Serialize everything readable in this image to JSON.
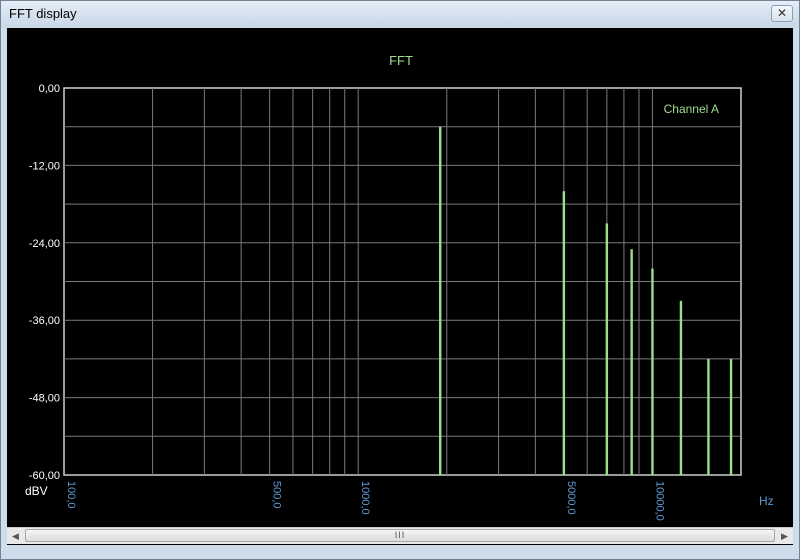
{
  "window": {
    "title": "FFT display",
    "close_glyph": "✕"
  },
  "scrollbar": {
    "left_arrow": "◀",
    "right_arrow": "▶",
    "grip": "III"
  },
  "colors": {
    "plot_background": "#000000",
    "grid": "#7a7a7a",
    "series": "#9edc8e",
    "x_tick": "#5b9bd5",
    "y_tick": "#ffffff"
  },
  "chart_data": {
    "type": "bar",
    "title": "FFT",
    "xlabel": "Hz",
    "ylabel": "dBV",
    "x_scale": "log",
    "xlim": [
      100,
      20000
    ],
    "ylim": [
      -60,
      0
    ],
    "x_ticks": [
      {
        "value": 100,
        "label": "100,0"
      },
      {
        "value": 500,
        "label": "500,0"
      },
      {
        "value": 1000,
        "label": "1000,0"
      },
      {
        "value": 5000,
        "label": "5000,0"
      },
      {
        "value": 10000,
        "label": "10000,0"
      }
    ],
    "y_ticks": [
      {
        "value": 0,
        "label": "0,00"
      },
      {
        "value": -12,
        "label": "-12,00"
      },
      {
        "value": -24,
        "label": "-24,00"
      },
      {
        "value": -36,
        "label": "-36,00"
      },
      {
        "value": -48,
        "label": "-48,00"
      },
      {
        "value": -60,
        "label": "-60,00"
      }
    ],
    "grid": true,
    "legend": "top-right",
    "series": [
      {
        "name": "Channel A",
        "x": [
          1900,
          5000,
          7000,
          8500,
          10000,
          12500,
          15500,
          18500
        ],
        "values": [
          -6,
          -16,
          -21,
          -25,
          -28,
          -33,
          -42,
          -42
        ]
      }
    ]
  }
}
